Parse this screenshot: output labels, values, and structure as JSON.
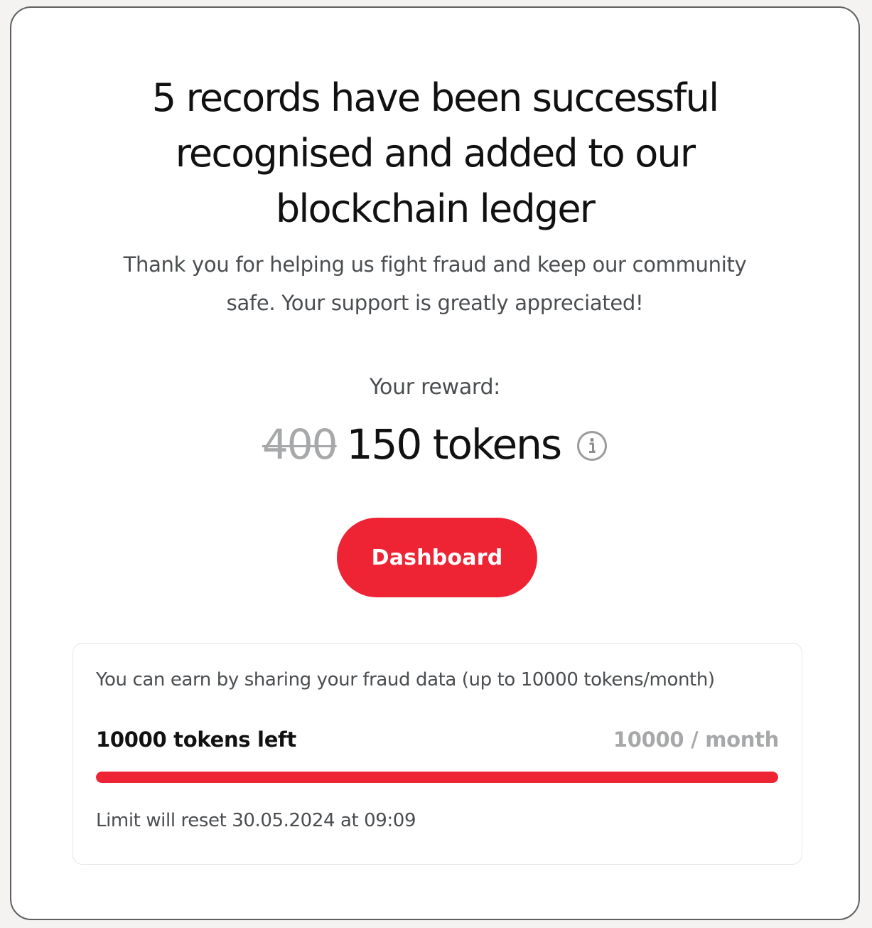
{
  "headline": {
    "line1": "5 records have been successful",
    "line2": "recognised and added to our",
    "line3": "blockchain ledger"
  },
  "subtext": {
    "line1": "Thank you for helping us fight fraud and keep our community",
    "line2": "safe. Your support is greatly appreciated!"
  },
  "reward": {
    "label": "Your reward:",
    "old_amount": "400",
    "new_amount": "150 tokens",
    "info_icon": "info-circle-icon"
  },
  "dashboard_button": {
    "label": "Dashboard"
  },
  "earn_box": {
    "description": "You can earn by sharing your fraud data (up to 10000 tokens/month)",
    "tokens_left": "10000 tokens left",
    "limit": "10000 / month",
    "progress_fraction": 1.0,
    "reset_text": "Limit will reset 30.05.2024 at 09:09"
  },
  "colors": {
    "accent": "#ee2333",
    "text_primary": "#111111",
    "text_secondary": "#4a4d50",
    "text_muted": "#a7a8aa"
  }
}
